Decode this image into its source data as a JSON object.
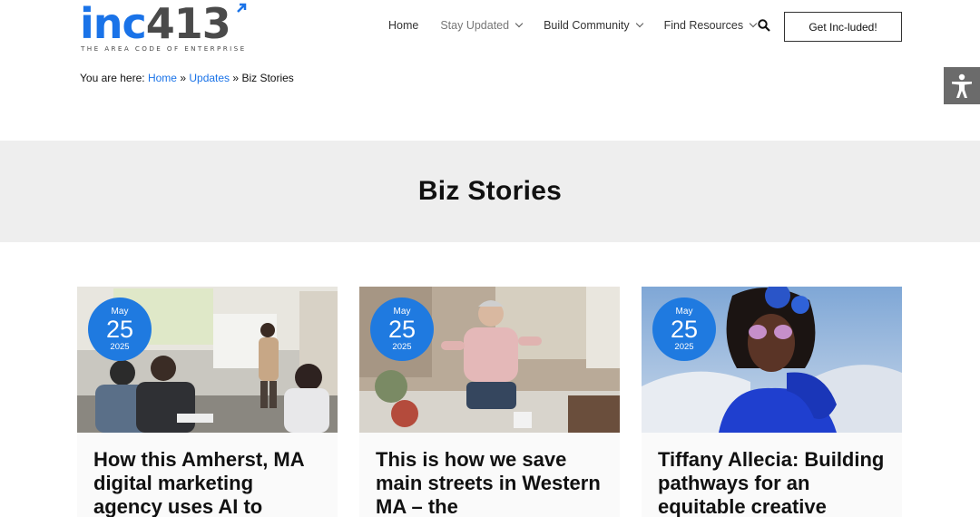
{
  "brand": {
    "logo_inc": "inc",
    "logo_num": "413",
    "tagline": "THE AREA CODE OF ENTERPRISE",
    "primary_color": "#1a73e8"
  },
  "nav": {
    "home": "Home",
    "stay_updated": "Stay Updated",
    "build_community": "Build Community",
    "find_resources": "Find Resources",
    "search_icon": "search-icon",
    "cta": "Get Inc-luded!"
  },
  "accessibility": {
    "icon": "accessibility-icon"
  },
  "breadcrumb": {
    "prefix": "You are here:",
    "home": "Home",
    "sep1": "»",
    "updates": "Updates",
    "sep2": "»",
    "current": "Biz Stories"
  },
  "page": {
    "title": "Biz Stories"
  },
  "posts": [
    {
      "month": "May",
      "day": "25",
      "year": "2025",
      "title": "How this Amherst, MA digital marketing agency uses AI to"
    },
    {
      "month": "May",
      "day": "25",
      "year": "2025",
      "title": "This is how we save main streets in Western MA – the"
    },
    {
      "month": "May",
      "day": "25",
      "year": "2025",
      "title": "Tiffany Allecia: Building pathways for an equitable creative"
    }
  ]
}
